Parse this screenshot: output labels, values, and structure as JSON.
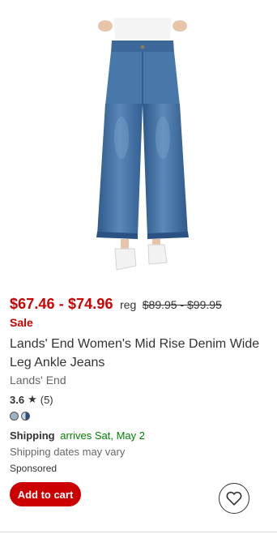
{
  "product": {
    "image_icon": "jeans-product-photo",
    "price_range": "$67.46 - $74.96",
    "reg_label": "reg",
    "reg_price": "$89.95 - $99.95",
    "sale_label": "Sale",
    "title": "Lands' End Women's Mid Rise Denim Wide Leg Ankle Jeans",
    "brand": "Lands' End",
    "rating": {
      "average": "3.6",
      "star_icon": "star-icon",
      "count": "(5)"
    },
    "swatches": [
      {
        "name": "light-wash",
        "color": "#9fb3c6"
      },
      {
        "name": "two-tone",
        "color": "#2f4d75"
      }
    ],
    "shipping": {
      "label": "Shipping",
      "arrives": "arrives Sat, May 2",
      "note": "Shipping dates may vary"
    },
    "sponsored": "Sponsored",
    "add_to_cart_label": "Add to cart",
    "favorite_icon": "heart-icon"
  },
  "colors": {
    "price_red": "#cc0000",
    "shipping_green": "#008300",
    "button_red": "#cc0000"
  }
}
